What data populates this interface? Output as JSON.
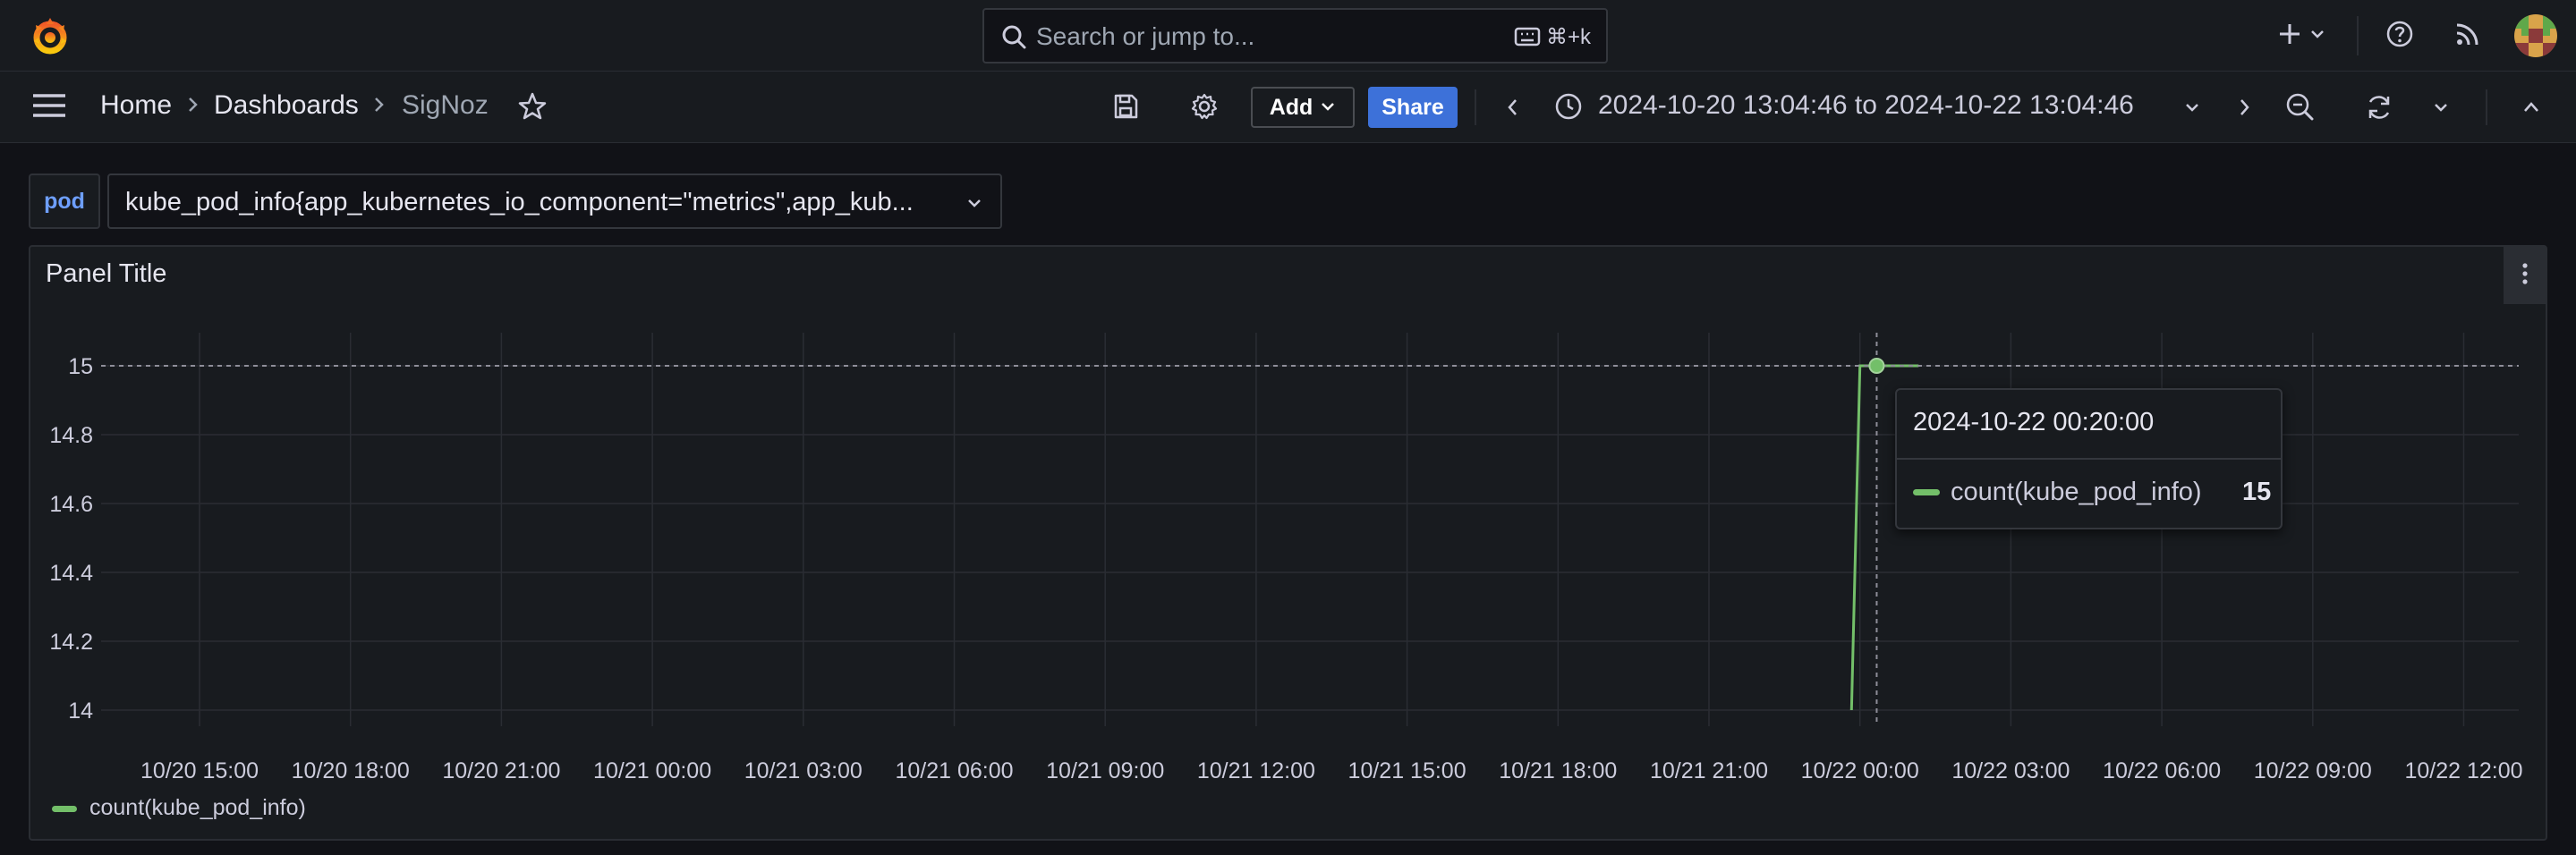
{
  "topbar": {
    "search_placeholder": "Search or jump to...",
    "search_shortcut": "⌘+k"
  },
  "breadcrumb": {
    "home": "Home",
    "dashboards": "Dashboards",
    "current": "SigNoz"
  },
  "toolbar": {
    "add_label": "Add",
    "share_label": "Share",
    "time_range": "2024-10-20 13:04:46 to 2024-10-22 13:04:46"
  },
  "variable": {
    "label": "pod",
    "value": "kube_pod_info{app_kubernetes_io_component=\"metrics\",app_kub..."
  },
  "panel": {
    "title": "Panel Title"
  },
  "tooltip": {
    "time": "2024-10-22 00:20:00",
    "series": "count(kube_pod_info)",
    "value": "15"
  },
  "colors": {
    "series": "#73bf69",
    "accent": "#3d71d9",
    "background": "#111217"
  },
  "chart_data": {
    "type": "line",
    "title": "Panel Title",
    "y_ticks": [
      "15",
      "14.8",
      "14.6",
      "14.4",
      "14.2",
      "14"
    ],
    "ylim": [
      14,
      15
    ],
    "x_ticks": [
      "10/20 15:00",
      "10/20 18:00",
      "10/20 21:00",
      "10/21 00:00",
      "10/21 03:00",
      "10/21 06:00",
      "10/21 09:00",
      "10/21 12:00",
      "10/21 15:00",
      "10/21 18:00",
      "10/21 21:00",
      "10/22 00:00",
      "10/22 03:00",
      "10/22 06:00",
      "10/22 09:00",
      "10/22 12:00"
    ],
    "xlim": [
      "2024-10-20 13:04:46",
      "2024-10-22 13:04:46"
    ],
    "series": [
      {
        "name": "count(kube_pod_info)",
        "points": [
          [
            "2024-10-21 23:50:00",
            14
          ],
          [
            "2024-10-22 00:00:00",
            15
          ],
          [
            "2024-10-22 00:20:00",
            15
          ],
          [
            "2024-10-22 01:10:00",
            15
          ]
        ]
      }
    ],
    "grid": true,
    "legend_position": "bottom-left"
  }
}
